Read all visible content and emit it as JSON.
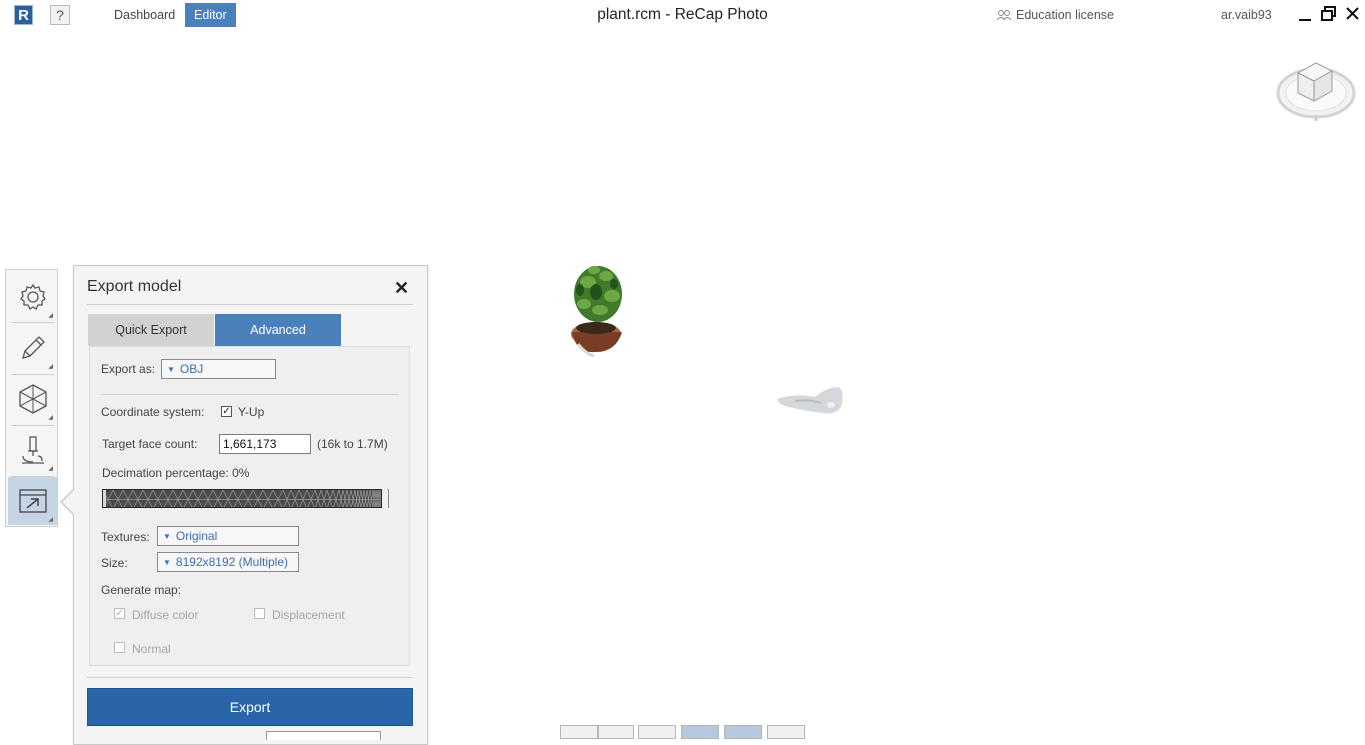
{
  "topbar": {
    "logo_letter": "R",
    "help_label": "?",
    "nav": [
      {
        "label": "Dashboard",
        "active": false
      },
      {
        "label": "Editor",
        "active": true
      }
    ],
    "title": "plant.rcm - ReCap Photo",
    "license_label": "Education license",
    "username": "ar.vaib93"
  },
  "toolbar": {
    "tools": [
      {
        "icon": "gear-icon",
        "active": false
      },
      {
        "icon": "pencil-icon",
        "active": false
      },
      {
        "icon": "mesh-icon",
        "active": false
      },
      {
        "icon": "microscope-icon",
        "active": false
      },
      {
        "icon": "export-icon",
        "active": true
      }
    ]
  },
  "export_panel": {
    "title": "Export model",
    "close_label": "✕",
    "tabs": [
      {
        "label": "Quick Export",
        "active": false
      },
      {
        "label": "Advanced",
        "active": true
      }
    ],
    "export_as_label": "Export as:",
    "export_as_value": "OBJ",
    "coordinate_system_label": "Coordinate system:",
    "coordinate_option": "Y-Up",
    "coordinate_checked": true,
    "target_face_label": "Target face count:",
    "target_face_value": "1,661,173",
    "target_face_range": "(16k to 1.7M)",
    "decimation_label": "Decimation percentage:",
    "decimation_value": "0%",
    "decimation_percent": 0,
    "textures_label": "Textures:",
    "textures_value": "Original",
    "size_label": "Size:",
    "size_value": "8192x8192 (Multiple)",
    "generate_map_label": "Generate map:",
    "maps": [
      {
        "label": "Diffuse color",
        "checked": true,
        "enabled": false
      },
      {
        "label": "Displacement",
        "checked": false,
        "enabled": false
      },
      {
        "label": "Normal",
        "checked": false,
        "enabled": false
      }
    ],
    "export_button": "Export"
  },
  "colors": {
    "accent": "#4a81bd",
    "export_button": "#2a65a8",
    "toolbar_active": "#c6d5e6"
  }
}
